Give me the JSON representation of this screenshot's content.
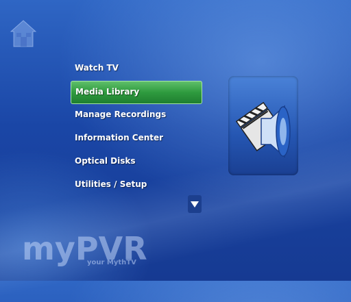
{
  "menu": {
    "items": [
      {
        "label": "Watch TV",
        "selected": false
      },
      {
        "label": "Media Library",
        "selected": true
      },
      {
        "label": "Manage Recordings",
        "selected": false
      },
      {
        "label": "Information Center",
        "selected": false
      },
      {
        "label": "Optical Disks",
        "selected": false
      },
      {
        "label": "Utilities / Setup",
        "selected": false
      }
    ]
  },
  "branding": {
    "logo": "myPVR",
    "tagline": "your MythTV"
  },
  "icons": {
    "home": "home-icon",
    "scroll": "arrow-down-icon",
    "preview": "media-library-icon"
  },
  "colors": {
    "background": "#1a46a6",
    "selection": "#2e9a3e",
    "selection_border": "#a8e6a8",
    "text": "#ffffff"
  }
}
